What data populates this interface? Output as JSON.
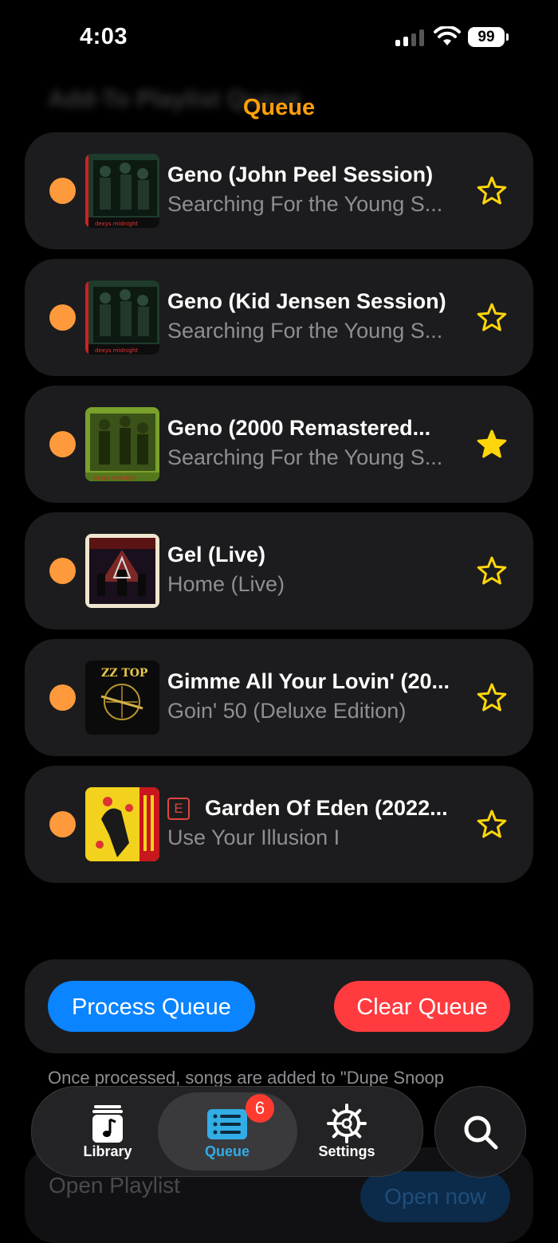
{
  "status_bar": {
    "time": "4:03",
    "battery": "99"
  },
  "ghost_header": "Add-To Playlist Queue",
  "page_title": "Queue",
  "queue": [
    {
      "title": "Geno (John Peel Session)",
      "subtitle": "Searching For the Young S...",
      "starred": false,
      "explicit": false,
      "art": "dexys-red"
    },
    {
      "title": "Geno (Kid Jensen Session)",
      "subtitle": "Searching For the Young S...",
      "starred": false,
      "explicit": false,
      "art": "dexys-red"
    },
    {
      "title": "Geno (2000 Remastered...",
      "subtitle": "Searching For the Young S...",
      "starred": true,
      "explicit": false,
      "art": "dexys-green"
    },
    {
      "title": "Gel (Live)",
      "subtitle": "Home (Live)",
      "starred": false,
      "explicit": false,
      "art": "concert"
    },
    {
      "title": "Gimme All Your Lovin' (20...",
      "subtitle": "Goin' 50 (Deluxe Edition)",
      "starred": false,
      "explicit": false,
      "art": "zz-top"
    },
    {
      "title": "Garden Of Eden (2022...",
      "subtitle": "Use Your Illusion I",
      "starred": false,
      "explicit": true,
      "explicit_label": "E",
      "art": "guns-n-roses"
    }
  ],
  "actions": {
    "process_label": "Process Queue",
    "clear_label": "Clear Queue"
  },
  "note": "Once processed, songs are added to \"Dupe Snoop",
  "open_playlist": {
    "label": "Open Playlist",
    "button": "Open now"
  },
  "tabs": [
    {
      "label": "Library",
      "icon": "music-note-icon"
    },
    {
      "label": "Queue",
      "icon": "list-icon",
      "badge": "6",
      "active": true
    },
    {
      "label": "Settings",
      "icon": "gear-icon"
    }
  ],
  "search": {
    "icon": "search-icon"
  },
  "colors": {
    "accent": "#ff9f0a",
    "dot": "#ff9a3c",
    "star": "#ffd60a",
    "primary": "#0a84ff",
    "danger": "#ff3b3f",
    "tab_active": "#32ade6",
    "card": "#1c1c1e"
  }
}
